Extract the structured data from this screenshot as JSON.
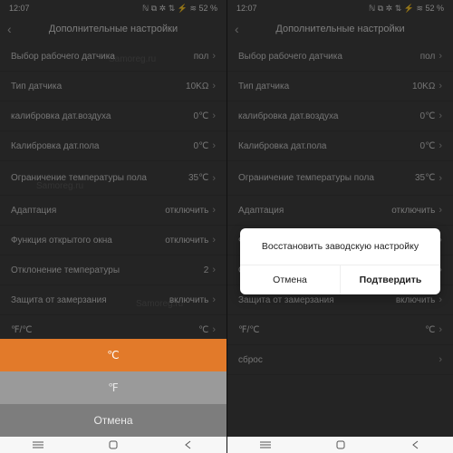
{
  "status": {
    "time": "12:07",
    "icons": "ℕ ⧉ ✲ ⇅ ⚡ ≋ 52 %",
    "battery": "52 %"
  },
  "header": {
    "title": "Дополнительные настройки"
  },
  "rows": [
    {
      "label": "Выбор рабочего датчика",
      "value": "пол"
    },
    {
      "label": "Тип датчика",
      "value": "10KΩ"
    },
    {
      "label": "калибровка дат.воздуха",
      "value": "0℃"
    },
    {
      "label": "Калибровка дат.пола",
      "value": "0℃"
    },
    {
      "label": "Ограничение температуры пола",
      "value": "35℃",
      "tall": true
    },
    {
      "label": "Адаптация",
      "value": "отключить"
    },
    {
      "label": "Функция открытого окна",
      "value": "отключить"
    },
    {
      "label": "Отклонение температуры",
      "value": "2"
    },
    {
      "label": "Защита от замерзания",
      "value": "включить"
    },
    {
      "label": "℉/℃",
      "value": "℃"
    },
    {
      "label": "сброс",
      "value": ""
    }
  ],
  "sheet": {
    "celsius": "℃",
    "fahrenheit": "℉",
    "cancel": "Отмена"
  },
  "dialog": {
    "title": "Восстановить заводскую настройку",
    "cancel": "Отмена",
    "confirm": "Подтвердить"
  },
  "watermark": "Samoreg.ru"
}
